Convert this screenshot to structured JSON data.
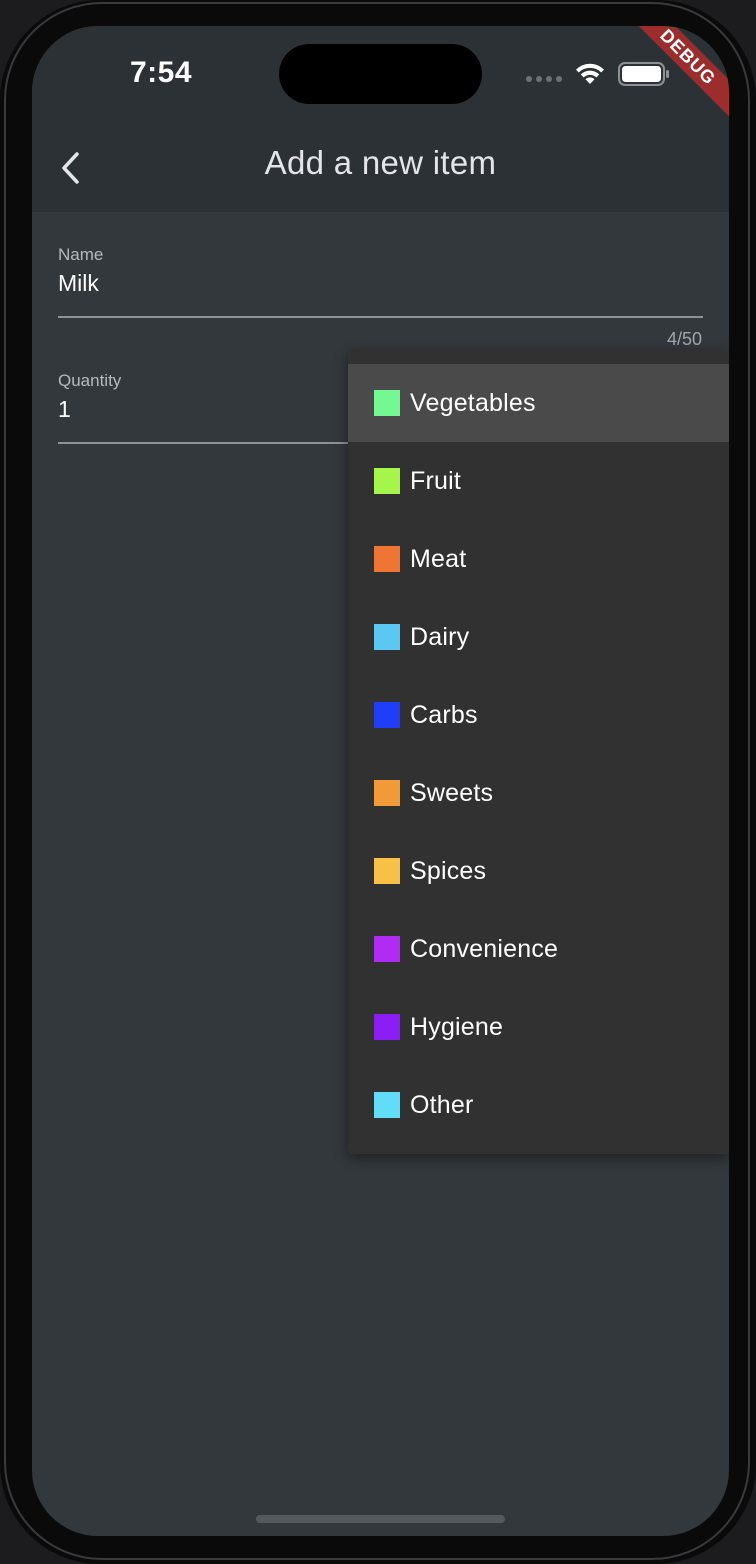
{
  "status_bar": {
    "time": "7:54",
    "wifi_icon": "wifi-icon",
    "battery_icon": "battery-icon"
  },
  "debug_banner": "DEBUG",
  "app_bar": {
    "back_icon": "chevron-left-icon",
    "title": "Add a new item"
  },
  "form": {
    "name": {
      "label": "Name",
      "value": "Milk",
      "counter": "4/50"
    },
    "quantity": {
      "label": "Quantity",
      "value": "1"
    }
  },
  "category_dropdown": {
    "selected": "Vegetables",
    "options": [
      {
        "label": "Vegetables",
        "color": "#74f892"
      },
      {
        "label": "Fruit",
        "color": "#a5f54b"
      },
      {
        "label": "Meat",
        "color": "#ef7535"
      },
      {
        "label": "Dairy",
        "color": "#5bc8f4"
      },
      {
        "label": "Carbs",
        "color": "#1f3ef5"
      },
      {
        "label": "Sweets",
        "color": "#f29a3a"
      },
      {
        "label": "Spices",
        "color": "#f6c146"
      },
      {
        "label": "Convenience",
        "color": "#b12cf2"
      },
      {
        "label": "Hygiene",
        "color": "#8a1ef4"
      },
      {
        "label": "Other",
        "color": "#62ddf8"
      }
    ]
  }
}
